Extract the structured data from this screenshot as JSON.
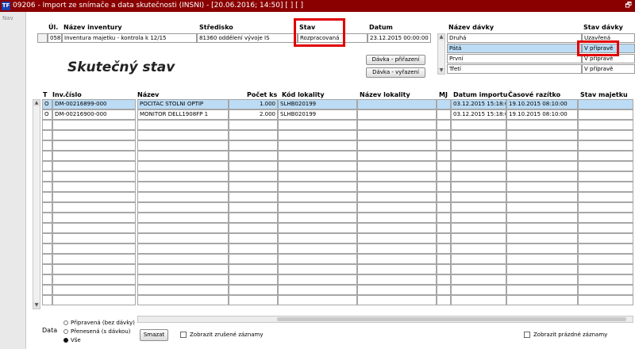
{
  "window": {
    "app_icon": "TF",
    "title": "09206 - Import ze snímače a data skutečnosti (INSNI) - [20.06.2016; 14:50]  [ ]  [ ]",
    "restore_glyph": "🗗"
  },
  "nav": {
    "label": "Nav"
  },
  "inventory": {
    "headers": {
      "ul": "Úl.",
      "nazev": "Název inventury",
      "stredisko": "Středisko",
      "stav": "Stav",
      "datum": "Datum"
    },
    "row": {
      "ul": "058",
      "nazev": "Inventura majetku - kontrola k 12/15",
      "stredisko": "81360 oddělení vývoje IS",
      "stav": "Rozpracovaná",
      "datum": "23.12.2015 00:00:00"
    }
  },
  "batches": {
    "headers": {
      "nazev": "Název dávky",
      "stav": "Stav dávky"
    },
    "rows": [
      {
        "nazev": "Druhá",
        "stav": "Uzavřená"
      },
      {
        "nazev": "Pátá",
        "stav": "V přípravě"
      },
      {
        "nazev": "První",
        "stav": "V přípravě"
      },
      {
        "nazev": "Třetí",
        "stav": "V přípravě"
      }
    ],
    "selected_index": 1
  },
  "section_title": "Skutečný stav",
  "buttons": {
    "prirazeni": "Dávka - přiřazení",
    "vyrazeni": "Dávka - vyřazení",
    "smazat": "Smazat"
  },
  "grid": {
    "headers": {
      "t": "T",
      "inv": "Inv.číslo",
      "nazev": "Název",
      "pocet": "Počet ks",
      "kod": "Kód lokality",
      "nazev_lok": "Název lokality",
      "mj": "MJ",
      "datum_importu": "Datum importu",
      "razitko": "Časové razítko",
      "stav_majetku": "Stav majetku"
    },
    "rows": [
      {
        "t": "O",
        "inv": "DM-00216899-000",
        "nazev": "POCITAC STOLNI OPTIP",
        "pocet": "1.000",
        "kod": "SLHB020199",
        "nazev_lok": "",
        "mj": "",
        "datum_importu": "03.12.2015 15:18:0",
        "razitko": "19.10.2015 08:10:00",
        "stav_majetku": ""
      },
      {
        "t": "O",
        "inv": "DM-00216900-000",
        "nazev": "MONITOR DELL1908FP 1",
        "pocet": "2.000",
        "kod": "SLHB020199",
        "nazev_lok": "",
        "mj": "",
        "datum_importu": "03.12.2015 15:18:0",
        "razitko": "19.10.2015 08:10:00",
        "stav_majetku": ""
      }
    ]
  },
  "filter": {
    "label": "Data",
    "options": [
      "Připravená (bez dávky)",
      "Přenesená (s dávkou)",
      "Vše"
    ],
    "selected_index": 2
  },
  "checkboxes": {
    "zrusene": "Zobrazit zrušené záznamy",
    "prazdne": "Zobrazit prázdné záznamy"
  },
  "colors": {
    "titlebar": "#8a0000",
    "highlight_box": "#e00000",
    "selected_row": "#bcdcf5"
  }
}
